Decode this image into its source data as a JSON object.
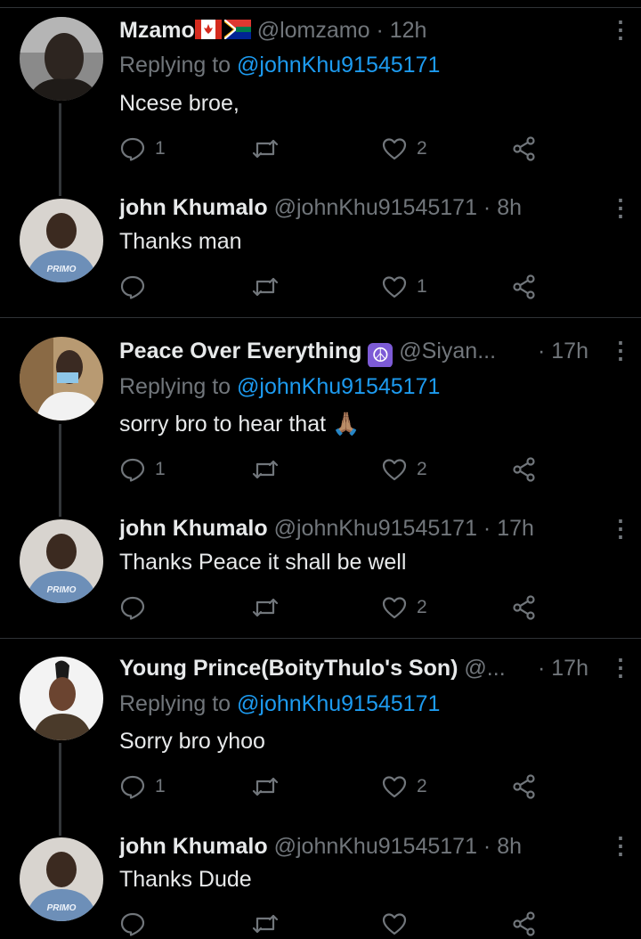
{
  "tweets": [
    {
      "name": "Mzamo",
      "flags": [
        "ca-flag",
        "za-flag"
      ],
      "handle": "@lomzamo",
      "time": "· 12h",
      "replying_prefix": "Replying to ",
      "replying_to": "@johnKhu91545171",
      "text": "Ncese broe,",
      "counts": {
        "reply": "1",
        "retweet": "",
        "like": "2"
      }
    },
    {
      "name": "john Khumalo",
      "handle": "@johnKhu91545171",
      "time": "· 8h",
      "text": "Thanks man",
      "counts": {
        "reply": "",
        "retweet": "",
        "like": "1"
      }
    },
    {
      "name": "Peace Over Everything",
      "badge": "☮",
      "handle": "@Siyan...",
      "time": "· 17h",
      "replying_prefix": "Replying to ",
      "replying_to": "@johnKhu91545171",
      "text": "sorry bro to hear that",
      "emoji": "🙏🏽",
      "counts": {
        "reply": "1",
        "retweet": "",
        "like": "2"
      }
    },
    {
      "name": "john Khumalo",
      "handle": "@johnKhu91545171",
      "time": "· 17h",
      "text": "Thanks Peace it shall be well",
      "counts": {
        "reply": "",
        "retweet": "",
        "like": "2"
      }
    },
    {
      "name": "Young Prince(BoityThulo's Son)",
      "handle": "@...",
      "time": "· 17h",
      "replying_prefix": "Replying to ",
      "replying_to": "@johnKhu91545171",
      "text": "Sorry bro yhoo",
      "counts": {
        "reply": "1",
        "retweet": "",
        "like": "2"
      }
    },
    {
      "name": "john Khumalo",
      "handle": "@johnKhu91545171",
      "time": "· 8h",
      "text": "Thanks Dude",
      "counts": {
        "reply": "",
        "retweet": "",
        "like": ""
      }
    }
  ],
  "avatar_shirt_text": "PRIMO",
  "colors": {
    "background": "#000000",
    "text": "#e7e9ea",
    "muted": "#71767b",
    "link": "#1d9bf0",
    "divider": "#2f3336"
  }
}
